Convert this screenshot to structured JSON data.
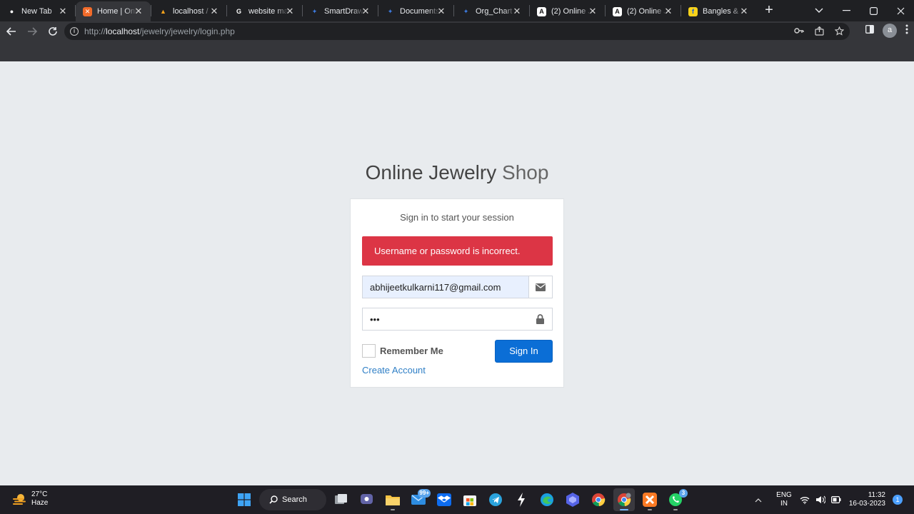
{
  "browser": {
    "tabs": [
      {
        "title": "New Tab",
        "favicon": "chrome-icon",
        "color": "#ffffff",
        "active": false
      },
      {
        "title": "Home | Onl",
        "favicon": "xampp-icon",
        "color": "#f26b2a",
        "active": true
      },
      {
        "title": "localhost /",
        "favicon": "phpmyadmin-icon",
        "color": "#f7a21b",
        "active": false
      },
      {
        "title": "website ma",
        "favicon": "google-icon",
        "color": "#ffffff",
        "active": false
      },
      {
        "title": "SmartDraw",
        "favicon": "smartdraw-icon",
        "color": "#3d7be0",
        "active": false
      },
      {
        "title": "Documents",
        "favicon": "smartdraw-icon",
        "color": "#3d7be0",
        "active": false
      },
      {
        "title": "Org_Chart -",
        "favicon": "smartdraw-icon",
        "color": "#3d7be0",
        "active": false
      },
      {
        "title": "(2) Online J",
        "favicon": "a-icon",
        "color": "#ffffff",
        "active": false
      },
      {
        "title": "(2) Online J",
        "favicon": "a-icon",
        "color": "#ffffff",
        "active": false
      },
      {
        "title": "Bangles & E",
        "favicon": "flipkart-icon",
        "color": "#f7d21b",
        "active": false
      }
    ],
    "url_scheme": "http://",
    "url_host": "localhost",
    "url_path": "/jewelry/jewelry/login.php",
    "profile_initial": "a"
  },
  "login": {
    "logo_bold": "Online Jewelry",
    "logo_light": " Shop",
    "box_message": "Sign in to start your session",
    "error_message": "Username or password is incorrect.",
    "email_value": "abhijeetkulkarni117@gmail.com",
    "password_value": "•••",
    "remember_label": "Remember Me",
    "signin_label": "Sign In",
    "create_account_label": "Create Account",
    "colors": {
      "error": "#dc3545",
      "primary": "#0b6ed6",
      "link": "#2f7fc6"
    }
  },
  "taskbar": {
    "temperature": "27°C",
    "weather": "Haze",
    "search_label": "Search",
    "mail_badge": "99+",
    "whatsapp_badge": "3",
    "lang_line1": "ENG",
    "lang_line2": "IN",
    "time": "11:32",
    "date": "16-03-2023",
    "notification_count": "1"
  }
}
